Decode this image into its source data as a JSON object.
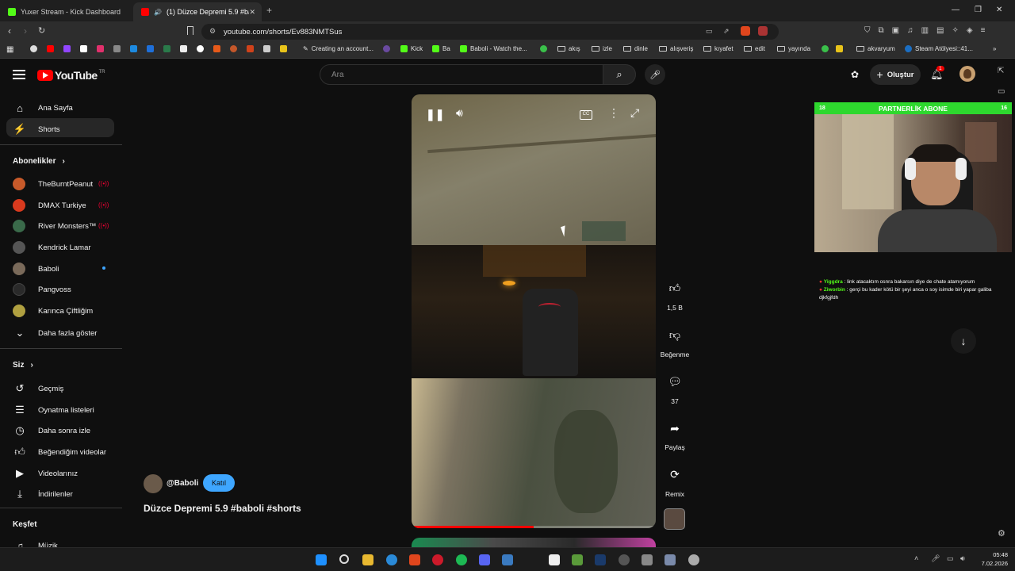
{
  "browser": {
    "tabs": [
      {
        "title": "Yuxer Stream - Kick Dashboard",
        "favicon_color": "#53fc18"
      },
      {
        "title": "(1) Düzce Depremi 5.9 #babo",
        "favicon_color": "#ff0000"
      }
    ],
    "url": "youtube.com/shorts/Ev883NMTSus",
    "bookmarks": [
      {
        "label": "Creating an account...",
        "type": "site"
      },
      {
        "label": "Kick",
        "type": "site"
      },
      {
        "label": "Ba",
        "type": "site"
      },
      {
        "label": "Baboli - Watch the...",
        "type": "site"
      },
      {
        "label": "akış",
        "type": "folder"
      },
      {
        "label": "izle",
        "type": "folder"
      },
      {
        "label": "dinle",
        "type": "folder"
      },
      {
        "label": "alışveriş",
        "type": "folder"
      },
      {
        "label": "kıyafet",
        "type": "folder"
      },
      {
        "label": "edit",
        "type": "folder"
      },
      {
        "label": "yayında",
        "type": "folder"
      },
      {
        "label": "akvaryum",
        "type": "folder"
      },
      {
        "label": "Steam Atölyesi::41...",
        "type": "site"
      }
    ]
  },
  "youtube": {
    "logo_text": "YouTube",
    "logo_region": "TR",
    "search_placeholder": "Ara",
    "create_label": "Oluştur",
    "notification_count": "1",
    "sidebar": {
      "home": "Ana Sayfa",
      "shorts": "Shorts",
      "subscriptions_title": "Abonelikler",
      "channels": [
        {
          "name": "TheBurntPeanut",
          "live": true,
          "color": "#c85a2a"
        },
        {
          "name": "DMAX Turkiye",
          "live": true,
          "color": "#d93a1e"
        },
        {
          "name": "River Monsters™",
          "live": true,
          "color": "#3a6a4a"
        },
        {
          "name": "Kendrick Lamar",
          "live": false,
          "color": "#555555"
        },
        {
          "name": "Baboli",
          "live": false,
          "new": true,
          "color": "#7a6a5a"
        },
        {
          "name": "Pangvoss",
          "live": false,
          "color": "#2a2a2a"
        },
        {
          "name": "Karınca Çiftliğim",
          "live": false,
          "color": "#b0a040"
        }
      ],
      "show_more": "Daha fazla göster",
      "you_title": "Siz",
      "you_items": [
        "Geçmiş",
        "Oynatma listeleri",
        "Daha sonra izle",
        "Beğendiğim videolar",
        "Videolarınız",
        "İndirilenler"
      ],
      "explore_title": "Keşfet",
      "explore_items": [
        "Müzik"
      ]
    },
    "short": {
      "channel": "@Baboli",
      "join_label": "Katıl",
      "title": "Düzce Depremi 5.9 #baboli #shorts",
      "likes": "1,5 B",
      "dislike_label": "Beğenme",
      "comments": "37",
      "share_label": "Paylaş",
      "remix_label": "Remix",
      "progress": 0.5
    }
  },
  "stream_overlay": {
    "header_left": "18",
    "header_title": "PARTNERLİK ABONE",
    "header_right": "16",
    "chat": [
      {
        "user": "Yiggdra",
        "message": "link atacaktım osnra bakarsın diye de chate atamıyorum",
        "user_color": "#53fc18"
      },
      {
        "user": "Ziworbin",
        "message": "gerçi bu kader kötü bir şeyi anca o soy isimde biri yapar galiba djkfgjfdh",
        "user_color": "#53fc18"
      }
    ]
  },
  "taskbar": {
    "time": "05:48",
    "date": "7.02.2026"
  }
}
